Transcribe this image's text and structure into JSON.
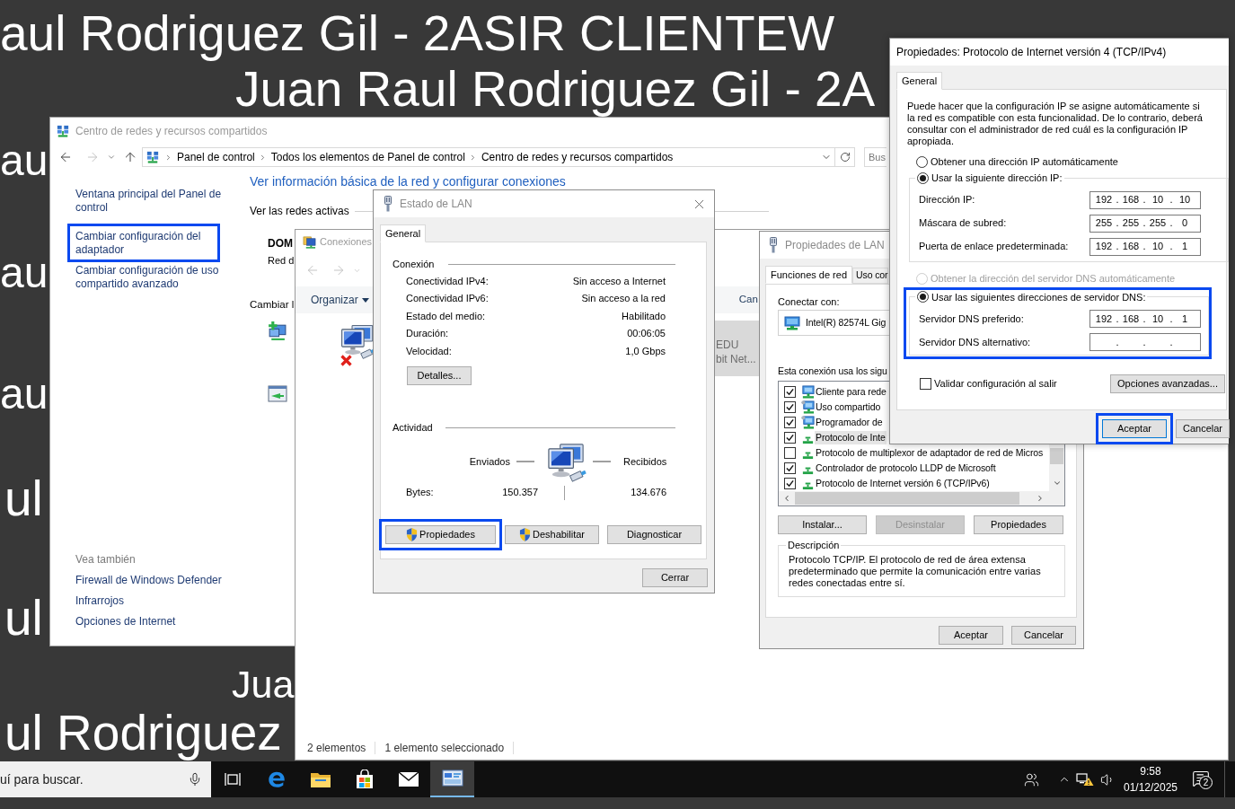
{
  "wallpaper": {
    "texts": [
      "aul Rodriguez Gil - 2ASIR CLIENTEW",
      "Juan Raul Rodriguez Gil - 2A",
      "au",
      "au",
      "au",
      "ul",
      "ul",
      "Jua",
      "ul Rodriguez"
    ]
  },
  "network_center": {
    "title": "Centro de redes y recursos compartidos",
    "breadcrumb": [
      "Panel de control",
      "Todos los elementos de Panel de control",
      "Centro de redes y recursos compartidos"
    ],
    "search": {
      "placeholder": "Bus"
    },
    "sidebar_links": [
      {
        "label": "Ventana principal del Panel de control",
        "highlighted": false
      },
      {
        "label": "Cambiar configuración del adaptador",
        "highlighted": true
      },
      {
        "label": "Cambiar configuración de uso compartido avanzado",
        "highlighted": false
      }
    ],
    "see_also": {
      "heading": "Vea también",
      "links": [
        "Firewall de Windows Defender",
        "Infrarrojos",
        "Opciones de Internet"
      ]
    },
    "heading": "Ver información básica de la red y configurar conexiones",
    "active_networks": "Ver las redes activas",
    "network": {
      "name": "DOM",
      "category": "Red d"
    },
    "change_settings": "Cambiar l"
  },
  "connections_window": {
    "title": "Conexiones",
    "toolbar": {
      "organize": "Organizar",
      "action": "Can"
    },
    "adapters": [
      {
        "selected": false,
        "disconnected": true
      },
      {
        "selected": true,
        "lines": [
          "EDU",
          "bit Net..."
        ]
      }
    ],
    "status": [
      "2 elementos",
      "1 elemento seleccionado"
    ]
  },
  "status_dialog": {
    "title": "Estado de LAN",
    "tabs": [
      {
        "label": "General",
        "selected": true
      }
    ],
    "connection": {
      "heading": "Conexión",
      "rows": [
        {
          "label": "Conectividad IPv4:",
          "value": "Sin acceso a Internet"
        },
        {
          "label": "Conectividad IPv6:",
          "value": "Sin acceso a la red"
        },
        {
          "label": "Estado del medio:",
          "value": "Habilitado"
        },
        {
          "label": "Duración:",
          "value": "00:06:05"
        },
        {
          "label": "Velocidad:",
          "value": "1,0 Gbps"
        }
      ],
      "details_button": "Detalles..."
    },
    "activity": {
      "heading": "Actividad",
      "sent_label": "Enviados",
      "received_label": "Recibidos",
      "bytes_label": "Bytes:",
      "bytes_sent": "150.357",
      "bytes_received": "134.676"
    },
    "buttons": [
      {
        "label": "Propiedades",
        "shield": true,
        "highlighted": true
      },
      {
        "label": "Deshabilitar",
        "shield": true,
        "highlighted": false
      },
      {
        "label": "Diagnosticar",
        "shield": false,
        "highlighted": false
      }
    ],
    "close_button": "Cerrar"
  },
  "lan_properties": {
    "title": "Propiedades de LAN",
    "tabs": [
      {
        "label": "Funciones de red",
        "selected": true
      },
      {
        "label": "Uso cor",
        "selected": false
      }
    ],
    "connect_using_label": "Conectar con:",
    "adapter": "Intel(R) 82574L Gig",
    "items_label": "Esta conexión usa los sigu",
    "items": [
      {
        "kind": "client",
        "label": "Cliente para rede",
        "checked": true,
        "selected": false
      },
      {
        "kind": "service",
        "label": "Uso compartido",
        "checked": true,
        "selected": false
      },
      {
        "kind": "service",
        "label": "Programador de",
        "checked": true,
        "selected": false
      },
      {
        "kind": "protocol",
        "label": "Protocolo de Inte",
        "checked": true,
        "selected": true
      },
      {
        "kind": "protocol",
        "label": "Protocolo de multiplexor de adaptador de red de Micros",
        "checked": false,
        "selected": false
      },
      {
        "kind": "protocol",
        "label": "Controlador de protocolo LLDP de Microsoft",
        "checked": true,
        "selected": false
      },
      {
        "kind": "protocol",
        "label": "Protocolo de Internet versión 6 (TCP/IPv6)",
        "checked": true,
        "selected": false
      }
    ],
    "buttons": [
      {
        "label": "Instalar...",
        "disabled": false
      },
      {
        "label": "Desinstalar",
        "disabled": true
      },
      {
        "label": "Propiedades",
        "disabled": false
      }
    ],
    "description": {
      "heading": "Descripción",
      "text": "Protocolo TCP/IP. El protocolo de red de área extensa predeterminado que permite la comunicación entre varias redes conectadas entre sí."
    },
    "footer_buttons": [
      "Aceptar",
      "Cancelar"
    ]
  },
  "ipv4_dialog": {
    "title": "Propiedades: Protocolo de Internet versión 4 (TCP/IPv4)",
    "tabs": [
      {
        "label": "General",
        "selected": true
      }
    ],
    "intro": "Puede hacer que la configuración IP se asigne automáticamente si la red es compatible con esta funcionalidad. De lo contrario, deberá consultar con el administrador de red cuál es la configuración IP apropiada.",
    "dot": ".",
    "ip_mode": [
      {
        "label": "Obtener una dirección IP automáticamente",
        "selected": false
      },
      {
        "label": "Usar la siguiente dirección IP:",
        "selected": true
      }
    ],
    "ip_fields": [
      {
        "label": "Dirección IP:",
        "octets": [
          "192",
          "168",
          "10",
          "10"
        ]
      },
      {
        "label": "Máscara de subred:",
        "octets": [
          "255",
          "255",
          "255",
          "0"
        ]
      },
      {
        "label": "Puerta de enlace predeterminada:",
        "octets": [
          "192",
          "168",
          "10",
          "1"
        ]
      }
    ],
    "dns_mode": [
      {
        "label": "Obtener la dirección del servidor DNS automáticamente",
        "selected": false,
        "disabled": true
      },
      {
        "label": "Usar las siguientes direcciones de servidor DNS:",
        "selected": true,
        "disabled": false
      }
    ],
    "dns_highlighted": true,
    "dns_fields": [
      {
        "label": "Servidor DNS preferido:",
        "octets": [
          "192",
          "168",
          "10",
          "1"
        ]
      },
      {
        "label": "Servidor DNS alternativo:"
      }
    ],
    "validate": {
      "label": "Validar configuración al salir",
      "checked": false
    },
    "advanced_button": "Opciones avanzadas...",
    "buttons": [
      {
        "label": "Aceptar",
        "highlighted": true,
        "default": true
      },
      {
        "label": "Cancelar",
        "highlighted": false,
        "default": false
      }
    ]
  },
  "taskbar": {
    "search": {
      "placeholder": "uí para buscar."
    },
    "apps": [
      {
        "kind": "task_view",
        "active": false
      },
      {
        "kind": "browser",
        "active": false
      },
      {
        "kind": "explorer",
        "active": false
      },
      {
        "kind": "store",
        "active": false
      },
      {
        "kind": "mail",
        "active": false
      },
      {
        "kind": "control_panel",
        "active": true
      }
    ],
    "time": "9:58",
    "date": "01/12/2025",
    "notifications": "2"
  }
}
